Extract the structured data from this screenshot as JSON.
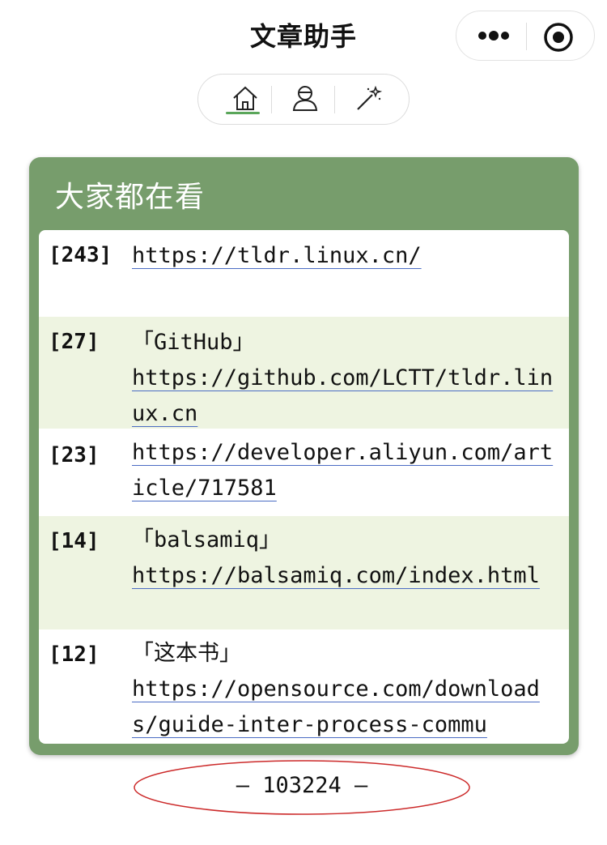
{
  "header": {
    "title": "文章助手"
  },
  "capsule": {
    "more_icon": "more-dots-icon",
    "close_icon": "target-circle-icon"
  },
  "tabs": [
    {
      "name": "home",
      "icon": "home-icon",
      "active": true
    },
    {
      "name": "user",
      "icon": "user-icon",
      "active": false
    },
    {
      "name": "magic",
      "icon": "magic-wand-icon",
      "active": false
    }
  ],
  "colors": {
    "card_green": "#779d6c",
    "row_alt": "#eef4e1",
    "active_tab": "#5aa65a",
    "footer_ellipse": "#cc2a2a"
  },
  "popular": {
    "title": "大家都在看",
    "items": [
      {
        "count": "[243]",
        "label": "",
        "url": "https://tldr.linux.cn/"
      },
      {
        "count": "[27]",
        "label": "「GitHub」",
        "url": "https://github.com/LCTT/tldr.linux.cn"
      },
      {
        "count": "[23]",
        "label": "",
        "url": "https://developer.aliyun.com/article/717581"
      },
      {
        "count": "[14]",
        "label": "「balsamiq」",
        "url": "https://balsamiq.com/index.html"
      },
      {
        "count": "[12]",
        "label": "「这本书」",
        "url": "https://opensource.com/downloads/guide-inter-process-commu"
      }
    ]
  },
  "footer": {
    "text": "— 103224 —"
  }
}
